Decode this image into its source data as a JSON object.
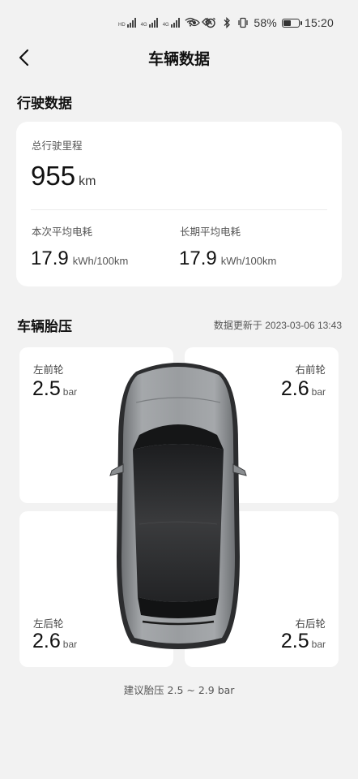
{
  "status_bar": {
    "network_tags": [
      "HD",
      "4G",
      "4G"
    ],
    "battery_percent": "58%",
    "battery_level": 0.58,
    "time": "15:20",
    "icons": [
      "signal-icon",
      "wifi-icon",
      "nfc-icon",
      "eye-icon",
      "alarm-icon",
      "bluetooth-icon",
      "vibrate-icon",
      "battery-icon"
    ]
  },
  "nav": {
    "back_icon": "chevron-left-icon",
    "title": "车辆数据"
  },
  "driving": {
    "section_title": "行驶数据",
    "total_mileage_label": "总行驶里程",
    "total_mileage_value": "955",
    "total_mileage_unit": "km",
    "current_consumption_label": "本次平均电耗",
    "current_consumption_value": "17.9",
    "current_consumption_unit": "kWh/100km",
    "longterm_consumption_label": "长期平均电耗",
    "longterm_consumption_value": "17.9",
    "longterm_consumption_unit": "kWh/100km"
  },
  "tire": {
    "section_title": "车辆胎压",
    "update_text": "数据更新于 2023-03-06 13:43",
    "unit": "bar",
    "front_left": {
      "label": "左前轮",
      "value": "2.5"
    },
    "front_right": {
      "label": "右前轮",
      "value": "2.6"
    },
    "rear_left": {
      "label": "左后轮",
      "value": "2.6"
    },
    "rear_right": {
      "label": "右后轮",
      "value": "2.5"
    },
    "suggestion": "建议胎压 2.5 ~ 2.9 bar"
  },
  "colors": {
    "background": "#f2f2f2",
    "card": "#ffffff",
    "car_body": "#8e9194",
    "car_roof": "#2a2b2d"
  }
}
